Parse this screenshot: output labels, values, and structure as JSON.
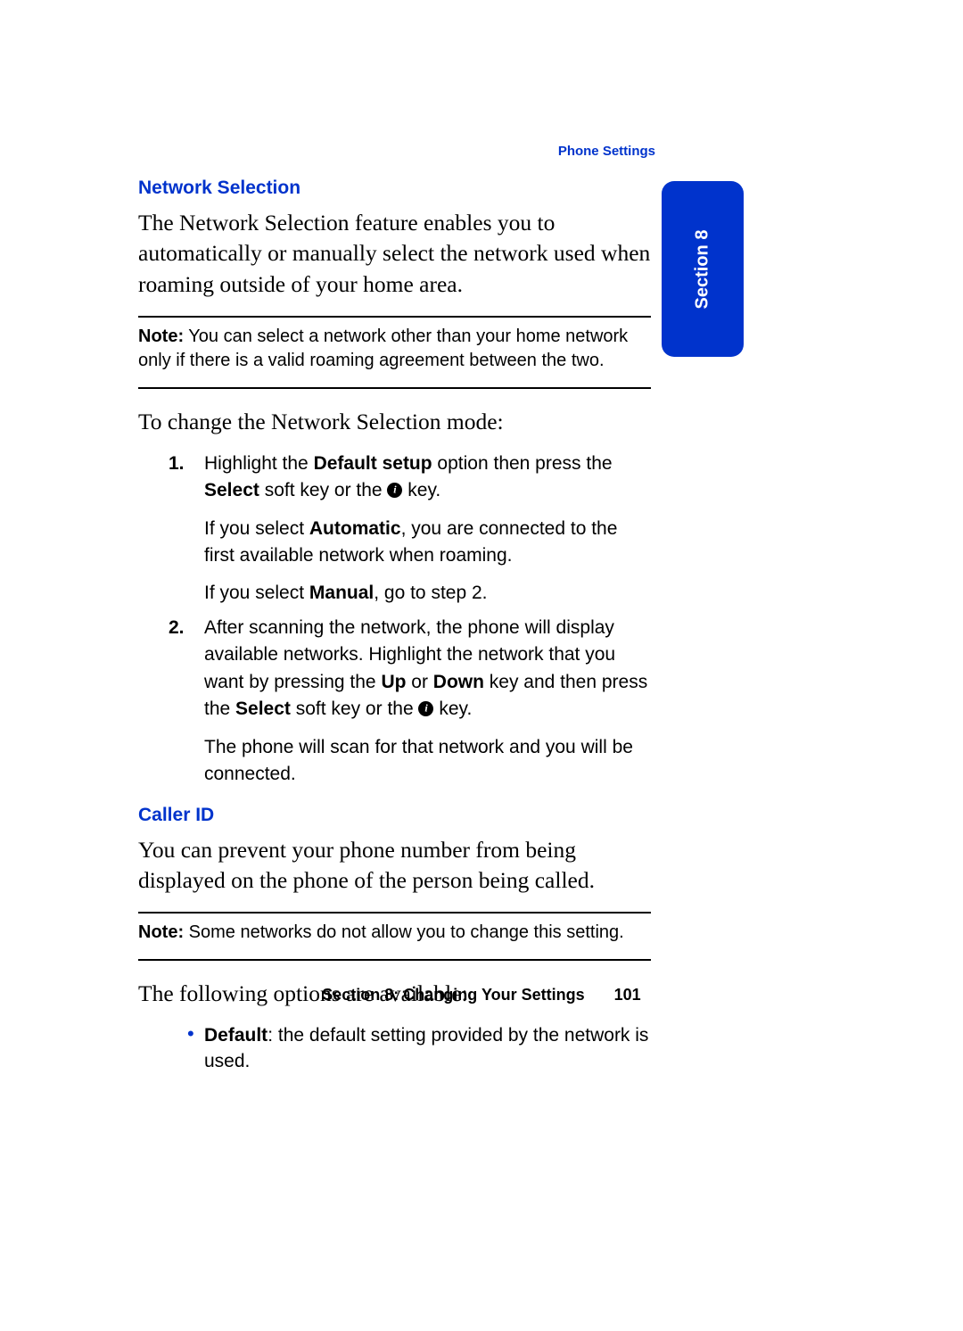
{
  "header": {
    "breadcrumb": "Phone Settings"
  },
  "tab": {
    "label": "Section 8"
  },
  "network_selection": {
    "heading": "Network Selection",
    "intro": "The Network Selection feature enables you to automatically or manually select the network used when roaming outside of your home area.",
    "note_label": "Note:",
    "note_body": " You can select a network other than your home network only if there is a valid roaming agreement between the two.",
    "lead": "To change the Network Selection mode:",
    "steps": [
      {
        "num": "1.",
        "l1a": "Highlight the ",
        "l1b": "Default setup",
        "l1c": " option then press the ",
        "l1d": "Select",
        "l1e": " soft key or the ",
        "l1f": " key.",
        "p2a": "If you select ",
        "p2b": "Automatic",
        "p2c": ", you are connected to the first available network when roaming.",
        "p3a": "If you select ",
        "p3b": "Manual",
        "p3c": ", go to step 2."
      },
      {
        "num": "2.",
        "l1a": "After scanning the network, the phone will display available networks. Highlight the network that you want by pressing the ",
        "l1b": "Up",
        "l1c": " or ",
        "l1d": "Down",
        "l1e": " key and then press the ",
        "l1f": "Select",
        "l1g": " soft key or the ",
        "l1h": " key.",
        "p2": "The phone will scan for that network and you will be connected."
      }
    ]
  },
  "caller_id": {
    "heading": "Caller ID",
    "intro": "You can prevent your phone number from being displayed on the phone of the person being called.",
    "note_label": "Note:",
    "note_body": " Some networks do not allow you to change this setting.",
    "lead": "The following options are available:",
    "bullets": [
      {
        "b": "Default",
        "rest": ": the default setting provided by the network is used."
      }
    ]
  },
  "footer": {
    "chapter": "Section 8: Changing Your Settings",
    "page": "101"
  }
}
